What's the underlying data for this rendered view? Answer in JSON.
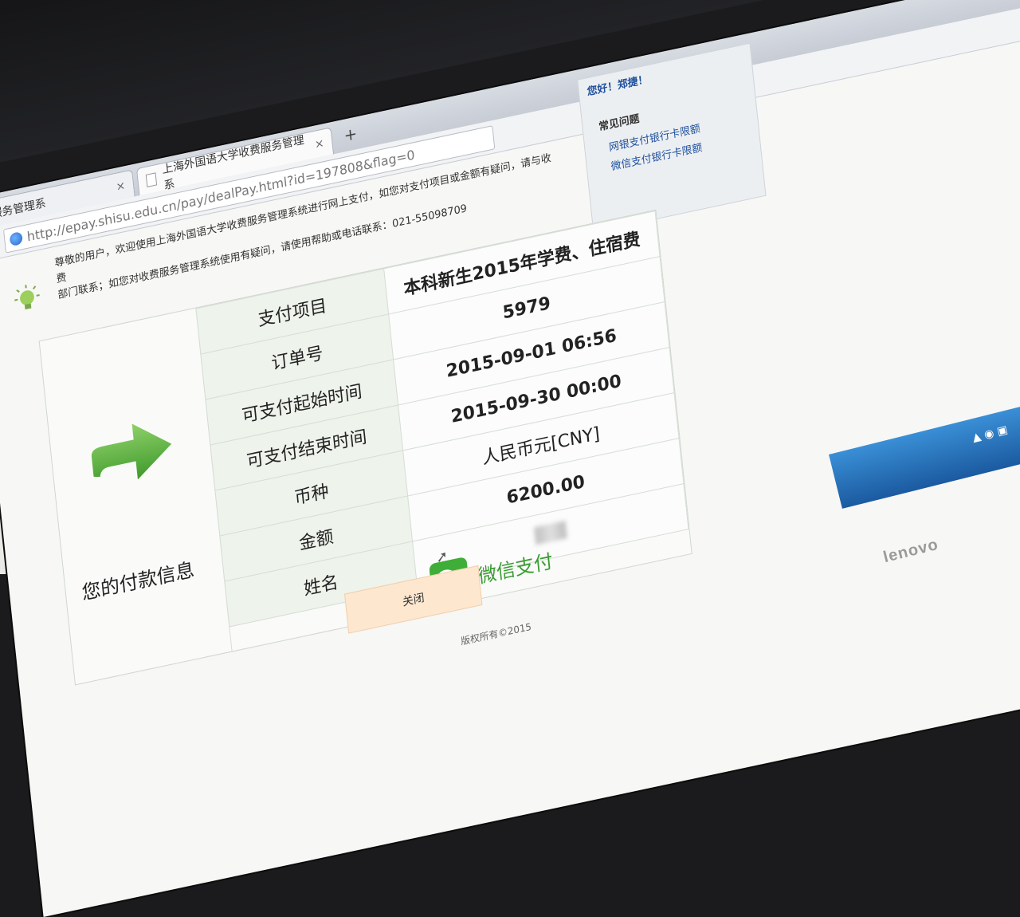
{
  "browser": {
    "tabs": [
      {
        "label": "大学收费服务管理系"
      },
      {
        "label": "上海外国语大学收费服务管理系"
      }
    ],
    "new_tab": "+",
    "close_glyph": "×",
    "url": "http://epay.shisu.edu.cn/pay/dealPay.html?id=197808&flag=0"
  },
  "notice": {
    "line1": "尊敬的用户，欢迎使用上海外国语大学收费服务管理系统进行网上支付，如您对支付项目或金额有疑问，请与收费",
    "line2": "部门联系；如您对收费服务管理系统使用有疑问，请使用帮助或电话联系：021-55098709"
  },
  "sidebar": {
    "hello": "您好！郑捷！",
    "faq_title": "常见问题",
    "links": [
      "网银支付银行卡限额",
      "微信支付银行卡限额"
    ]
  },
  "payment": {
    "section_label": "您的付款信息",
    "rows": [
      {
        "key": "支付项目",
        "value": "本科新生2015年学费、住宿费"
      },
      {
        "key": "订单号",
        "value": "5979"
      },
      {
        "key": "可支付起始时间",
        "value": "2015-09-01 06:56"
      },
      {
        "key": "可支付结束时间",
        "value": "2015-09-30 00:00"
      },
      {
        "key": "币种",
        "value": "人民币元[CNY]"
      },
      {
        "key": "金额",
        "value": "6200.00"
      },
      {
        "key": "姓名",
        "value": ""
      }
    ]
  },
  "wechat_pay": "微信支付",
  "close_button": "关闭",
  "footer": "版权所有©2015",
  "laptop_brand": "lenovo",
  "colors": {
    "wechat_green": "#3fae38",
    "close_button_bg": "#fde7cf",
    "sidebar_bg": "#eceff2"
  }
}
